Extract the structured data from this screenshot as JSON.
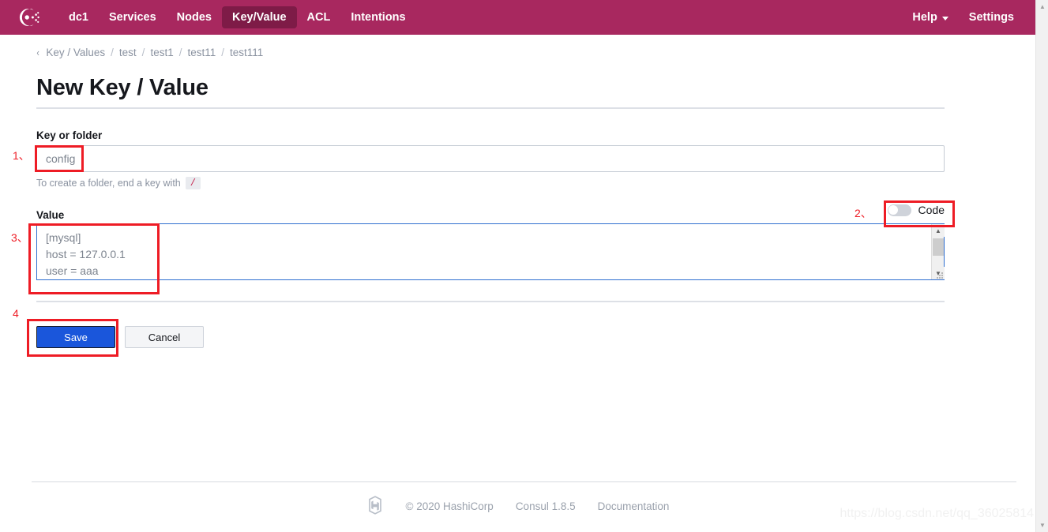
{
  "navbar": {
    "logo_icon": "consul-logo-icon",
    "items": [
      {
        "label": "dc1",
        "active": false
      },
      {
        "label": "Services",
        "active": false
      },
      {
        "label": "Nodes",
        "active": false
      },
      {
        "label": "Key/Value",
        "active": true
      },
      {
        "label": "ACL",
        "active": false
      },
      {
        "label": "Intentions",
        "active": false
      }
    ],
    "help_label": "Help",
    "settings_label": "Settings",
    "background_color": "#a8285f",
    "active_background_color": "#7e1b47"
  },
  "breadcrumb": {
    "back_glyph": "‹",
    "items": [
      "Key / Values",
      "test",
      "test1",
      "test11",
      "test111"
    ],
    "separator": "/"
  },
  "page": {
    "title": "New Key / Value"
  },
  "form": {
    "key_label": "Key or folder",
    "key_value": "config",
    "key_placeholder": "config",
    "hint_text": "To create a folder, end a key with",
    "hint_code": "/",
    "value_label": "Value",
    "code_toggle_label": "Code",
    "code_toggle_state": "off",
    "value_text": "[mysql]\nhost = 127.0.0.1\nuser = aaa"
  },
  "buttons": {
    "save_label": "Save",
    "cancel_label": "Cancel",
    "save_color": "#1a56db"
  },
  "annotations": [
    {
      "number": "1、",
      "target": "key-input"
    },
    {
      "number": "2、",
      "target": "code-toggle"
    },
    {
      "number": "3、",
      "target": "value-textarea"
    },
    {
      "number": "4",
      "target": "save-button"
    }
  ],
  "footer": {
    "logo_icon": "hashicorp-logo-icon",
    "copyright": "© 2020 HashiCorp",
    "version": "Consul 1.8.5",
    "documentation_label": "Documentation"
  },
  "watermark": {
    "text": "https://blog.csdn.net/qq_36025814"
  }
}
